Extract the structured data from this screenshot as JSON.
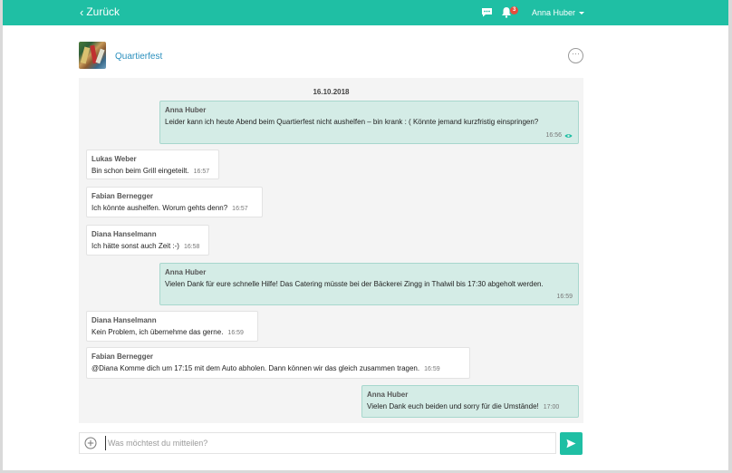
{
  "topbar": {
    "back_label": "Zurück",
    "notifications_count": "3",
    "user_name": "Anna Huber",
    "color": "#1fbfa4"
  },
  "group": {
    "name": "Quartierfest"
  },
  "chat": {
    "date": "16.10.2018",
    "messages": [
      {
        "sender": "Anna Huber",
        "text": "Leider kann ich heute Abend beim Quartierfest nicht aushelfen – bin krank : ( Könnte jemand kurzfristig einspringen?",
        "time": "16:56",
        "own": true
      },
      {
        "sender": "Lukas Weber",
        "text": "Bin schon beim Grill eingeteilt.",
        "time": "16:57",
        "own": false
      },
      {
        "sender": "Fabian Bernegger",
        "text": "Ich könnte aushelfen. Worum gehts denn?",
        "time": "16:57",
        "own": false
      },
      {
        "sender": "Diana Hanselmann",
        "text": "Ich hätte sonst auch Zeit :-)",
        "time": "16:58",
        "own": false
      },
      {
        "sender": "Anna Huber",
        "text": "Vielen Dank für eure schnelle Hilfe! Das Catering müsste bei der Bäckerei Zingg in Thalwil bis 17:30 abgeholt werden.",
        "time": "16:59",
        "own": true
      },
      {
        "sender": "Diana Hanselmann",
        "text": "Kein Problem, ich übernehme das gerne.",
        "time": "16:59",
        "own": false
      },
      {
        "sender": "Fabian Bernegger",
        "text": "@Diana Komme dich um 17:15 mit dem Auto abholen. Dann können wir das gleich zusammen tragen.",
        "time": "16:59",
        "own": false
      },
      {
        "sender": "Anna Huber",
        "text": "Vielen Dank euch beiden und sorry für die Umstände!",
        "time": "17:00",
        "own": true
      }
    ]
  },
  "composer": {
    "placeholder": "Was möchtest du mitteilen?"
  }
}
